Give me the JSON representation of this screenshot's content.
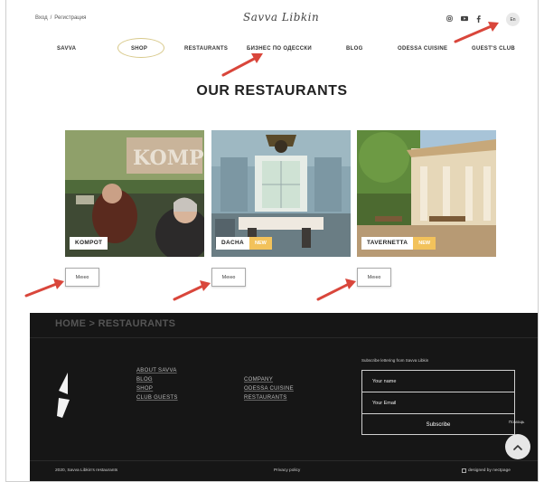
{
  "topbar": {
    "login": "Вход",
    "separator": "/",
    "register": "Регистрация",
    "logo_text": "Savva Libkin",
    "social_icons": [
      "instagram-icon",
      "youtube-icon",
      "facebook-icon"
    ],
    "lang": "En"
  },
  "nav": {
    "items": [
      "SAVVA",
      "SHOP",
      "RESTAURANTS",
      "БИЗНЕС ПО ОДЕССКИ",
      "BLOG",
      "ODESSA CUISINE",
      "GUEST'S CLUB"
    ]
  },
  "main": {
    "heading": "OUR RESTAURANTS",
    "cards": [
      {
        "name": "KOMPOT",
        "badge": "",
        "menu_label": "Меню"
      },
      {
        "name": "DACHA",
        "badge": "NEW",
        "menu_label": "Меню"
      },
      {
        "name": "TAVERNETTA",
        "badge": "NEW",
        "menu_label": "Меню"
      }
    ]
  },
  "footer": {
    "breadcrumb": "HOME > RESTAURANTS",
    "col1": [
      "ABOUT SAVVA",
      "BLOG",
      "SHOP",
      "CLUB GUESTS"
    ],
    "col2": [
      "COMPANY",
      "ODESSA CUISINE",
      "RESTAURANTS"
    ],
    "subscribe_title": "Subscribe lettering from Savva Libkin",
    "name_placeholder": "Your name",
    "email_placeholder": "Your Email",
    "subscribe_button": "Subscribe",
    "help_label": "Помощь",
    "scroll_top_icon": "chevron-up-icon",
    "copyright": "2020, Savva Libkin's restaurants",
    "privacy": "Privacy policy",
    "designed_by": "designed by nectpage"
  },
  "colors": {
    "accent": "#f2c25b",
    "footer_bg": "#161616",
    "arrow": "#d9463b"
  }
}
